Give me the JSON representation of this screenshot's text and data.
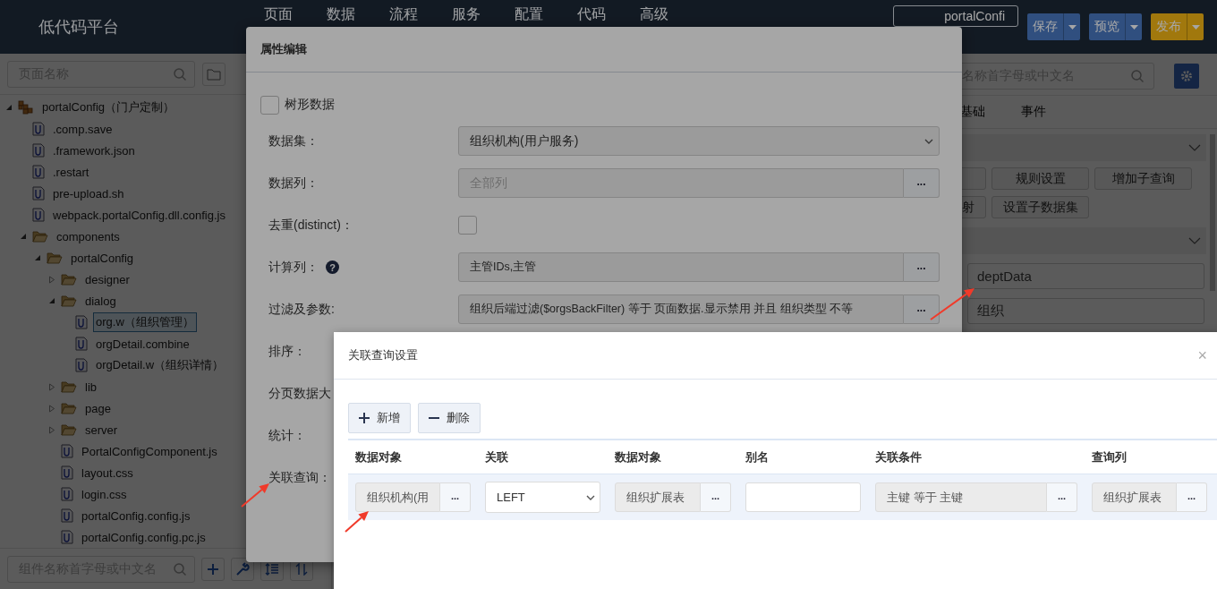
{
  "topbar": {
    "logo": "低代码平台",
    "nav": [
      {
        "label": "页面"
      },
      {
        "label": "数据"
      },
      {
        "label": "流程"
      },
      {
        "label": "服务"
      },
      {
        "label": "配置"
      },
      {
        "label": "代码"
      },
      {
        "label": "高级"
      }
    ],
    "page_field": {
      "value": "portalConfi"
    },
    "buttons": [
      {
        "label": "保存",
        "kind": "primary"
      },
      {
        "label": "预览",
        "kind": "primary"
      },
      {
        "label": "发布",
        "kind": "warning"
      }
    ]
  },
  "left_panel": {
    "search": {
      "placeholder": "页面名称"
    },
    "tree": [
      {
        "kind": "project",
        "label": "portalConfig（门户定制）",
        "expanded": true,
        "selected": false,
        "children": [
          {
            "kind": "file",
            "label": ".comp.save",
            "selected": false
          },
          {
            "kind": "file",
            "label": ".framework.json",
            "selected": false
          },
          {
            "kind": "file",
            "label": ".restart",
            "selected": false
          },
          {
            "kind": "file",
            "label": "pre-upload.sh",
            "selected": false
          },
          {
            "kind": "file",
            "label": "webpack.portalConfig.dll.config.js",
            "selected": false
          },
          {
            "kind": "folder",
            "label": "components",
            "expanded": true,
            "selected": false,
            "children": [
              {
                "kind": "folder",
                "label": "portalConfig",
                "expanded": true,
                "selected": false,
                "children": [
                  {
                    "kind": "folder",
                    "label": "designer",
                    "expanded": false,
                    "selected": false
                  },
                  {
                    "kind": "folder",
                    "label": "dialog",
                    "expanded": true,
                    "selected": false,
                    "children": [
                      {
                        "kind": "file",
                        "label": "org.w（组织管理）",
                        "selected": true
                      },
                      {
                        "kind": "file",
                        "label": "orgDetail.combine",
                        "selected": false
                      },
                      {
                        "kind": "file",
                        "label": "orgDetail.w（组织详情）",
                        "selected": false
                      }
                    ]
                  },
                  {
                    "kind": "folder",
                    "label": "lib",
                    "expanded": false,
                    "selected": false
                  },
                  {
                    "kind": "folder",
                    "label": "page",
                    "expanded": false,
                    "selected": false
                  },
                  {
                    "kind": "folder",
                    "label": "server",
                    "expanded": false,
                    "selected": false
                  },
                  {
                    "kind": "file",
                    "label": "PortalConfigComponent.js",
                    "selected": false
                  },
                  {
                    "kind": "file",
                    "label": "layout.css",
                    "selected": false
                  },
                  {
                    "kind": "file",
                    "label": "login.css",
                    "selected": false
                  },
                  {
                    "kind": "file",
                    "label": "portalConfig.config.js",
                    "selected": false
                  },
                  {
                    "kind": "file",
                    "label": "portalConfig.config.pc.js",
                    "selected": false
                  }
                ]
              }
            ]
          }
        ]
      }
    ],
    "component_search": {
      "placeholder": "组件名称首字母或中文名"
    },
    "tools": [
      {
        "kind": "add"
      },
      {
        "kind": "wrench"
      },
      {
        "kind": "indent"
      },
      {
        "kind": "sort"
      }
    ]
  },
  "right_panel": {
    "search": {
      "placeholder": "名称首字母或中文名"
    },
    "tabs": [
      {
        "label": "基础"
      },
      {
        "label": "事件"
      }
    ],
    "sections": [
      {
        "expanded": true,
        "button_rows": [
          [
            {
              "kind": "partial"
            },
            {
              "kind": "full",
              "label": "规则设置"
            },
            {
              "kind": "full",
              "label": "增加子查询"
            }
          ],
          [
            {
              "kind": "partial",
              "label": "射"
            },
            {
              "kind": "full",
              "label": "设置子数据集"
            }
          ]
        ]
      },
      {
        "expanded": true,
        "fields": [
          {
            "value": "deptData"
          },
          {
            "value": "组织"
          }
        ]
      }
    ]
  },
  "property_dialog": {
    "title": "属性编辑",
    "rows": [
      {
        "kind": "checkbox",
        "label": "树形数据",
        "checked": false
      },
      {
        "kind": "select",
        "label": "数据集：",
        "value": "组织机构(用户服务)"
      },
      {
        "kind": "picker",
        "label": "数据列：",
        "placeholder": "全部列",
        "action": "..."
      },
      {
        "kind": "check-field",
        "label": "去重(distinct)：",
        "checked": false
      },
      {
        "kind": "picker",
        "label": "计算列：",
        "help": "?",
        "value": "主管IDs,主管",
        "action": "..."
      },
      {
        "kind": "picker",
        "label": "过滤及参数:",
        "value": "组织后端过滤($orgsBackFilter) 等于 页面数据.显示禁用 并且 组织类型 不等",
        "action": "..."
      },
      {
        "kind": "label",
        "label": "排序："
      },
      {
        "kind": "label",
        "label": "分页数据大"
      },
      {
        "kind": "label",
        "label": "统计："
      },
      {
        "kind": "label",
        "label": "关联查询："
      }
    ]
  },
  "join_dialog": {
    "title": "关联查询设置",
    "close": "×",
    "toolbar": [
      {
        "kind": "add",
        "label": "新增"
      },
      {
        "kind": "remove",
        "label": "删除"
      }
    ],
    "table": {
      "columns": [
        "数据对象",
        "关联",
        "数据对象",
        "别名",
        "关联条件",
        "查询列"
      ],
      "rows": [
        {
          "selected": true,
          "cells": [
            {
              "kind": "picker",
              "value": "组织机构(用",
              "action": "..."
            },
            {
              "kind": "select",
              "value": "LEFT"
            },
            {
              "kind": "picker",
              "value": "组织扩展表",
              "action": "..."
            },
            {
              "kind": "input"
            },
            {
              "kind": "picker",
              "value": "主键 等于 主键",
              "action": "..."
            },
            {
              "kind": "picker",
              "value": "组织扩展表",
              "action": "..."
            }
          ]
        }
      ]
    }
  }
}
